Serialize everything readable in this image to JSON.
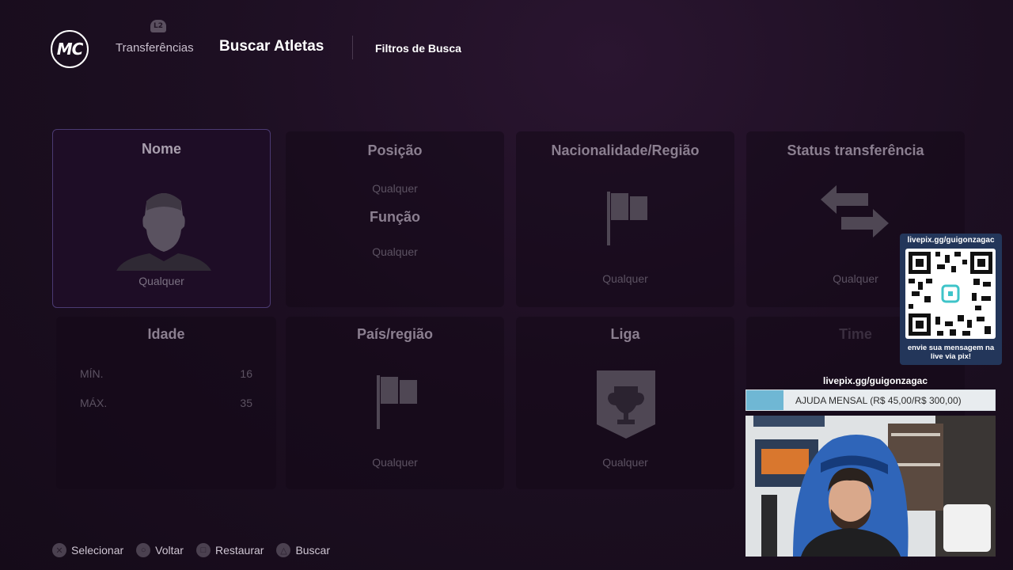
{
  "header": {
    "logo_text": "MC",
    "l2_badge": "L2",
    "tab_transferencias": "Transferências",
    "tab_buscar": "Buscar Atletas",
    "tab_filtros": "Filtros de Busca"
  },
  "cards": {
    "nome": {
      "title": "Nome",
      "value": "Qualquer"
    },
    "posicao": {
      "title": "Posição",
      "value": "Qualquer",
      "subtitle": "Função",
      "sub_value": "Qualquer"
    },
    "nacionalidade": {
      "title": "Nacionalidade/Região",
      "value": "Qualquer"
    },
    "status": {
      "title": "Status transferência",
      "value": "Qualquer"
    },
    "idade": {
      "title": "Idade",
      "min_label": "MÍN.",
      "min_value": "16",
      "max_label": "MÁX.",
      "max_value": "35"
    },
    "pais": {
      "title": "País/região",
      "value": "Qualquer"
    },
    "liga": {
      "title": "Liga",
      "value": "Qualquer"
    },
    "time": {
      "title": "Time"
    }
  },
  "footer": {
    "selecionar": "Selecionar",
    "voltar": "Voltar",
    "restaurar": "Restaurar",
    "buscar": "Buscar"
  },
  "overlay": {
    "qr_title": "livepix.gg/guigonzagac",
    "qr_caption": "envie sua mensagem na live via pix!",
    "url": "livepix.gg/guigonzagac",
    "goal_label": "AJUDA MENSAL (R$ 45,00/R$ 300,00)",
    "goal_fraction": 0.15,
    "goal_color": "#6fb7d4"
  },
  "colors": {
    "background": "#1d0f22",
    "selected_border": "#4b3a72"
  }
}
